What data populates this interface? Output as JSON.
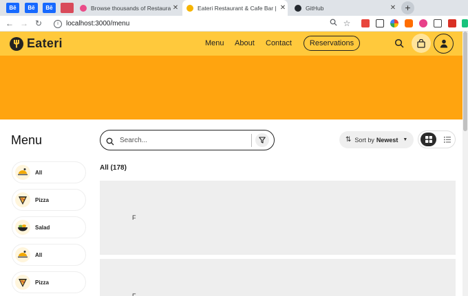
{
  "browser": {
    "tabs": [
      {
        "title": "Browse thousands of Restaurant",
        "active": false,
        "favicon_color": "#ea4c89"
      },
      {
        "title": "Eateri Restaurant & Cafe Bar | Th",
        "active": true,
        "favicon_color": "#f6b400"
      },
      {
        "title": "GitHub",
        "active": false,
        "favicon_color": "#24292f"
      }
    ],
    "pinned_label": "Bē",
    "address": "localhost:3000/menu"
  },
  "site": {
    "brand": "Eateri",
    "nav": [
      "Menu",
      "About",
      "Contact"
    ],
    "reservations_label": "Reservations",
    "brand_color": "#ffc93c",
    "hero_color": "#ffa40f"
  },
  "sidebar": {
    "title": "Menu",
    "categories": [
      {
        "label": "All",
        "icon": "dish-icon"
      },
      {
        "label": "Pizza",
        "icon": "pizza-icon"
      },
      {
        "label": "Salad",
        "icon": "salad-icon"
      },
      {
        "label": "All",
        "icon": "dish-icon"
      },
      {
        "label": "Pizza",
        "icon": "pizza-icon"
      }
    ]
  },
  "search": {
    "placeholder": "Search..."
  },
  "sort": {
    "prefix": "Sort by",
    "value": "Newest"
  },
  "results": {
    "count_label": "All (178)"
  },
  "cards": [
    {
      "placeholder": "F"
    },
    {
      "placeholder": "F"
    }
  ]
}
